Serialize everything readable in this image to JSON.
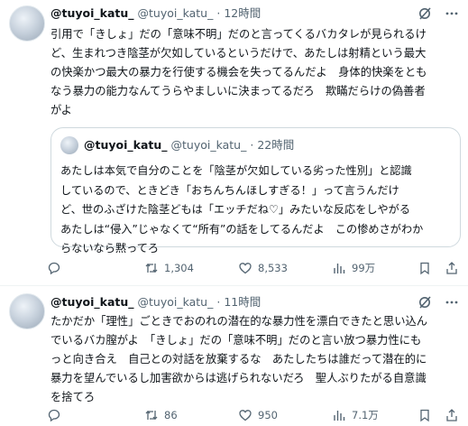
{
  "posts": [
    {
      "name": "@tuyoi_katu_",
      "handle": "@tuyoi_katu_",
      "dot": "·",
      "time": "12時間",
      "text": "引用で「きしょ」だの「意味不明」だのと言ってくるバカタレが見られるけ\nど、生まれつき陰茎が欠如しているというだけで、あたしは射精という最大\nの快楽かつ最大の暴力を行使する機会を失ってるんだよ　身体的快楽をとも\nなう暴力の能力なんてうらやましいに決まってるだろ　欺瞞だらけの偽善者\nがよ",
      "quote": {
        "name": "@tuyoi_katu_",
        "handle": "@tuyoi_katu_",
        "dot": "·",
        "time": "22時間",
        "text": "あたしは本気で自分のことを「陰茎が欠如している劣った性別」と認識\nしているので、ときどき「おちんちんほしすぎる！」って言うんだけ\nど、世のふざけた陰茎どもは「エッチだね♡」みたいな反応をしやがる\nあたしは“侵入”じゃなくて“所有”の話をしてるんだよ　この惨めさがわか\nらないなら黙ってろ"
      },
      "actions": {
        "replies": "",
        "reposts": "1,304",
        "likes": "8,533",
        "views": "99万"
      }
    },
    {
      "name": "@tuyoi_katu_",
      "handle": "@tuyoi_katu_",
      "dot": "·",
      "time": "11時間",
      "text": "たかだか「理性」ごときでおのれの潜在的な暴力性を漂白できたと思い込ん\nでいるバカ膣がよ　「きしょ」だの「意味不明」だのと言い放つ暴力性にも\nっと向き合え　自己との対話を放棄するな　あたしたちは誰だって潜在的に\n暴力を望んでいるし加害欲からは逃げられないだろ　聖人ぶりたがる自意識\nを捨てろ",
      "actions": {
        "replies": "",
        "reposts": "86",
        "likes": "950",
        "views": "7.1万"
      }
    }
  ],
  "colors": {
    "text": "#0f1419",
    "muted": "#536471",
    "border": "#cfd9de"
  },
  "icons": [
    "grok-icon",
    "more-icon",
    "reply-icon",
    "repost-icon",
    "like-icon",
    "views-icon",
    "bookmark-icon",
    "share-icon"
  ]
}
